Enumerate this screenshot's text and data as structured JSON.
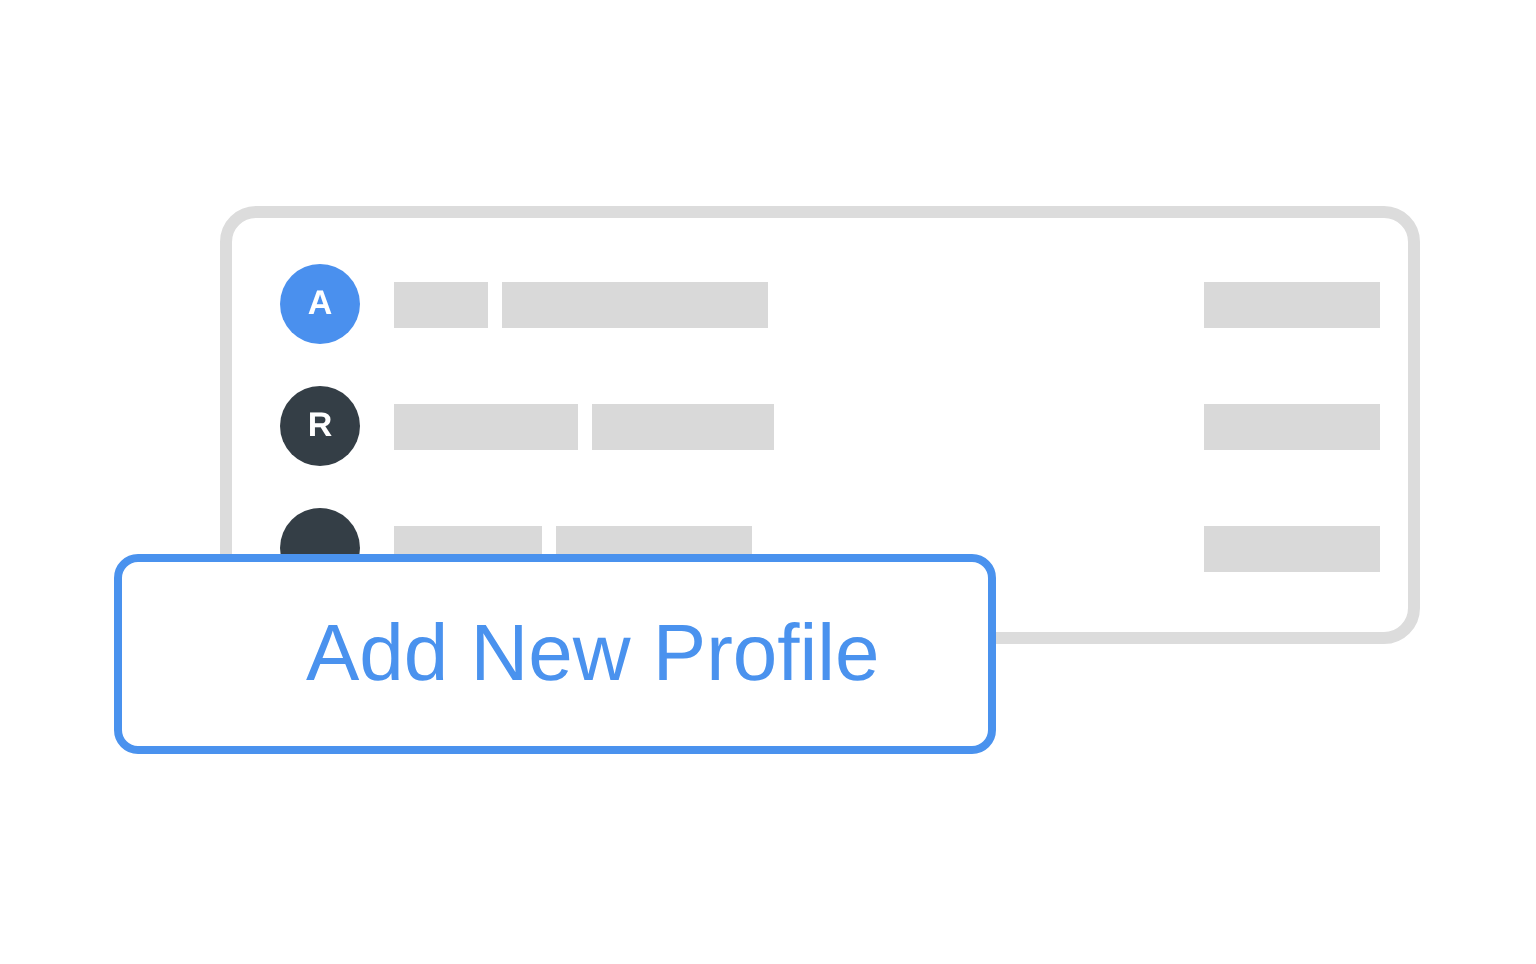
{
  "profiles": [
    {
      "initial": "A",
      "color": "#4a90ee"
    },
    {
      "initial": "R",
      "color": "#343e46"
    },
    {
      "color": "#343e46"
    }
  ],
  "add_button": {
    "label": "Add New Profile"
  }
}
